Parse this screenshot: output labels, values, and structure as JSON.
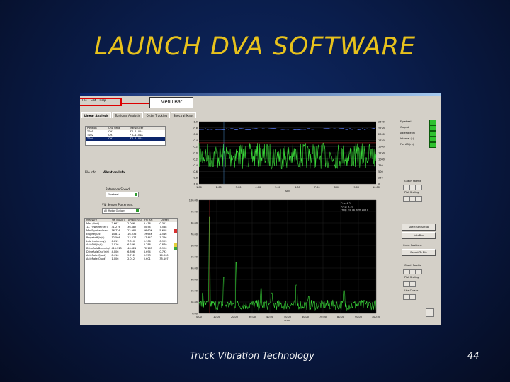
{
  "slide": {
    "title": "LAUNCH DVA SOFTWARE",
    "footer": "Truck Vibration Technology",
    "page_number": "44",
    "callout": "Menu Bar",
    "title_color": "#e8c21c",
    "background_color": "#0a1d4b"
  },
  "app": {
    "menu": [
      "File",
      "Edit",
      "Help"
    ],
    "tabs": [
      "Linear Analysis",
      "Torsional Analysis",
      "Order Tracking",
      "Spectral Maps"
    ],
    "position_table": {
      "headers": [
        "Position",
        "Ch1 Sens",
        "Transducer"
      ],
      "rows": [
        [
          "TS01",
          "CH1",
          "PTL-1101A"
        ],
        [
          "TS02",
          "CH1",
          "PTL-1101A"
        ],
        [
          "TS04",
          "CH1",
          "PTL-1101A"
        ]
      ],
      "selected_row": 2
    },
    "sub_tabs": [
      "File Info",
      "Vibration Info"
    ],
    "reference_speed": {
      "label": "Reference Speed",
      "value": "Flywheel"
    },
    "sensor_placement": {
      "label": "Vib Sensor Placement",
      "value": "All Motor Options"
    },
    "measure_table": {
      "headers": [
        "Measure",
        "Vel Bus(g)",
        "Ampl (in/s)",
        "Fr (Hz)",
        "Diesel"
      ],
      "rows": [
        [
          "Max (Amt)",
          "2.667",
          "2.066",
          "3.436",
          "0.321"
        ],
        [
          "1X Flywheel(sec)",
          "31.276",
          "36.487",
          "50.54",
          "7.588"
        ],
        [
          "Min Flywheel(sec)",
          "16.726",
          "22.982",
          "26.606",
          "5.658"
        ],
        [
          "Engine(Sec)",
          "14.812",
          "16.336",
          "19.646",
          "2.546"
        ],
        [
          "Propshaft(in/s)",
          "12.566",
          "13.377",
          "17.442",
          "1.766"
        ],
        [
          "Lubrication(ng)",
          "6.611",
          "7.310",
          "9.106",
          "0.993"
        ],
        [
          "AxleDiff(in/s)",
          "7.016",
          "6.236",
          "8.286",
          "0.870"
        ],
        [
          "DriveAxleBeam(in/s)",
          "411.225",
          "46.421",
          "72.165",
          "0.926"
        ],
        [
          "DriveAxleOsc(in/s)",
          "4.006",
          "6.896",
          "6.694",
          "0.792"
        ],
        [
          "AxleRate(Quad)",
          "8.416",
          "3.712",
          "3.553",
          "10.300"
        ],
        [
          "AxleRate(Quad)",
          "1.006",
          "2.012",
          "0.601",
          "35.107"
        ]
      ],
      "swatch_colors": [
        "#ffffff",
        "#ffffff",
        "#d93030",
        "#ffffff",
        "#ffffff",
        "#ffffff",
        "#e5d13a",
        "#39a839",
        "#ffffff",
        "#ffffff",
        "#ffffff"
      ]
    },
    "chart_top": {
      "y_ticks": [
        "1.0",
        "0.8",
        "0.6",
        "0.4",
        "0.2",
        "0.0",
        "-0.2",
        "-0.4",
        "-0.6",
        "-0.8",
        "-1.0"
      ],
      "x_ticks": [
        "1.00",
        "2.00",
        "3.00",
        "4.00",
        "5.00",
        "6.00",
        "7.00",
        "8.00",
        "9.00",
        "10.00"
      ],
      "rpm_ticks": [
        "2500",
        "2250",
        "2000",
        "1750",
        "1500",
        "1250",
        "1000",
        "750",
        "500",
        "250",
        "0"
      ],
      "xlabel": "Sec"
    },
    "chart_bottom": {
      "y_ticks": [
        "100.00",
        "90.00",
        "80.00",
        "70.00",
        "60.00",
        "50.00",
        "40.00",
        "30.00",
        "20.00",
        "10.00",
        "0.00"
      ],
      "x_ticks": [
        "0.00",
        "10.00",
        "20.00",
        "30.00",
        "40.00",
        "50.00",
        "60.00",
        "70.00",
        "80.00",
        "90.00",
        "100.00"
      ],
      "xlabel": "order",
      "readout": [
        "Cur: 4.2",
        "Amp: 1.22",
        "Freq: 25.78 RPM 1037"
      ]
    },
    "status_leds": [
      {
        "label": "Flywheel",
        "color": "#2fc12f"
      },
      {
        "label": "Output",
        "color": "#2fc12f"
      },
      {
        "label": "AxleRate (f)",
        "color": "#2fc12f"
      },
      {
        "label": "Interval (s)",
        "color": "#2fc12f"
      },
      {
        "label": "Fix. AB (rs)",
        "color": "#2fc12f"
      }
    ],
    "right_buttons": {
      "graph_palette": "Graph Palette",
      "plot_scaling": "Plot Scaling",
      "spectrum_setup": "Spectrum Setup",
      "auto_run": "AutoRun",
      "order_positions": "Order Positions",
      "export_file": "Export To File",
      "graph_palette2": "Graph Palette",
      "plot_scaling2": "Plot Scaling",
      "cursor": "Use Cursor"
    }
  }
}
